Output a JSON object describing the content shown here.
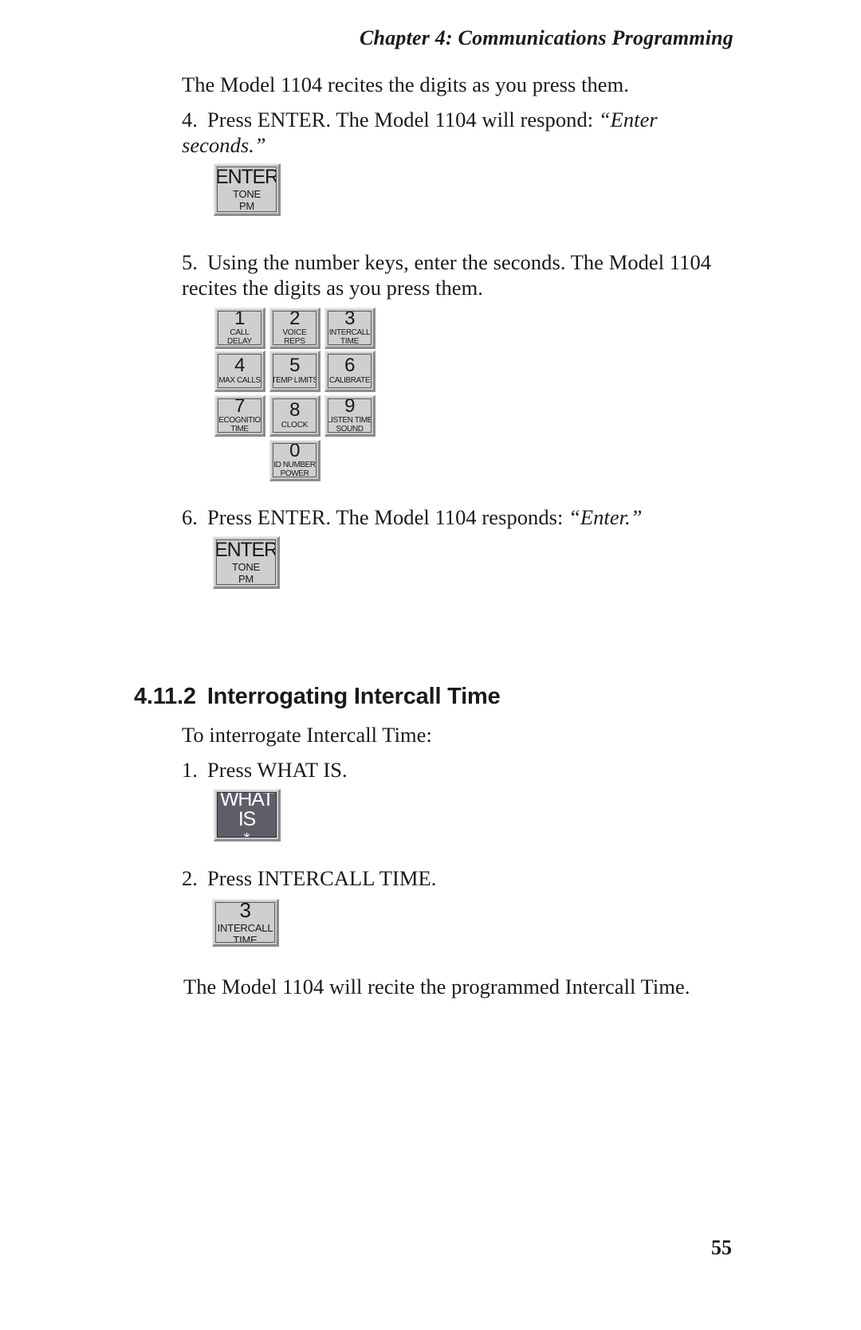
{
  "running_head": "Chapter 4:  Communications Programming",
  "page_number": "55",
  "paragraphs": {
    "intro": "The Model 1104 recites the digits as you press them.",
    "step4_num": "4.",
    "step4_a": "Press ENTER. The Model 1104 will respond: ",
    "step4_quote": "“Enter seconds.”",
    "step5_num": "5.",
    "step5": "Using the number keys, enter the seconds. The Model 1104 recites the digits as you press them.",
    "step6_num": "6.",
    "step6_a": "Press ENTER. The Model 1104 responds: ",
    "step6_quote": "“Enter.”",
    "intro_interrogate": "To interrogate Intercall Time:",
    "istep1_num": "1.",
    "istep1": "Press WHAT IS.",
    "istep2_num": "2.",
    "istep2": "Press INTERCALL TIME.",
    "closing": "The Model 1104 will recite the programmed Intercall Time."
  },
  "section": {
    "number": "4.11.2",
    "title": "Interrogating Intercall Time"
  },
  "keys": {
    "enter": {
      "main": "ENTER",
      "sub1": "TONE",
      "sub2": "PM"
    },
    "what_is": {
      "main": "WHAT",
      "sub1": "IS",
      "sub2": "∗"
    },
    "intercall": {
      "main": "3",
      "sub1": "INTERCALL",
      "sub2": "TIME"
    },
    "keypad": [
      {
        "main": "1",
        "sub1": "CALL",
        "sub2": "DELAY"
      },
      {
        "main": "2",
        "sub1": "VOICE",
        "sub2": "REPS"
      },
      {
        "main": "3",
        "sub1": "INTERCALL",
        "sub2": "TIME"
      },
      {
        "main": "4",
        "sub1": "MAX CALLS",
        "sub2": ""
      },
      {
        "main": "5",
        "sub1": "TEMP LIMITS",
        "sub2": ""
      },
      {
        "main": "6",
        "sub1": "CALIBRATE",
        "sub2": ""
      },
      {
        "main": "7",
        "sub1": "RECOGNITION",
        "sub2": "TIME"
      },
      {
        "main": "8",
        "sub1": "CLOCK",
        "sub2": ""
      },
      {
        "main": "9",
        "sub1": "LISTEN TIME",
        "sub2": "SOUND"
      },
      {
        "main": "0",
        "sub1": "ID NUMBER",
        "sub2": "POWER"
      }
    ]
  },
  "colors": {
    "key_face": "#cfcfcf",
    "key_bezel": "#c9c9c9",
    "key_border": "#5b5b6b",
    "key_dark_face": "#5e5e68",
    "text": "#1a1a1a",
    "page_background": "#ffffff"
  }
}
